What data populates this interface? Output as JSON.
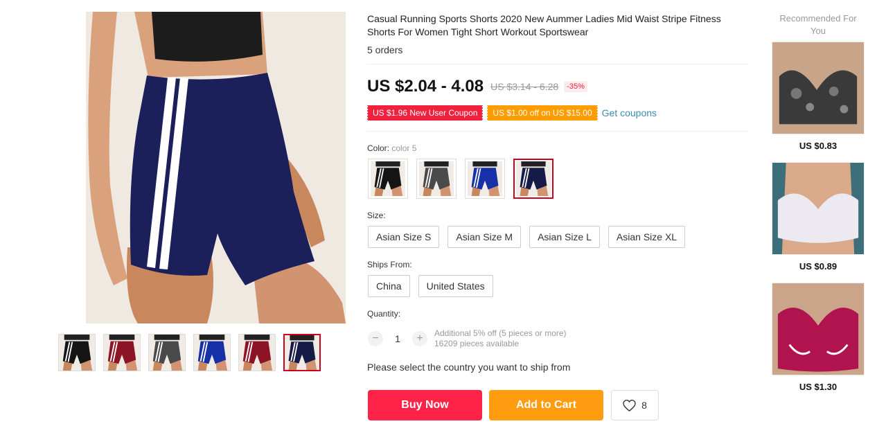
{
  "product": {
    "title": "Casual Running Sports Shorts 2020 New Aummer Ladies Mid Waist Stripe Fitness Shorts For Women Tight Short Workout Sportswear",
    "orders": "5 orders",
    "price": "US $2.04 - 4.08",
    "original_price": "US $3.14 - 6.28",
    "discount": "-35%",
    "coupons": [
      "US $1.96 New User Coupon",
      "US $1.00 off on US $15.00"
    ],
    "get_coupons": "Get coupons"
  },
  "gallery": {
    "thumb_colors": [
      "#151515",
      "#8c1424",
      "#4a4a4a",
      "#1630a8",
      "#8c1424",
      "#161a46"
    ],
    "selected_index": 5
  },
  "color": {
    "label": "Color:",
    "selected": "color 5",
    "swatch_colors": [
      "#151515",
      "#4a4a4a",
      "#1630a8",
      "#161a46"
    ]
  },
  "size": {
    "label": "Size:",
    "options": [
      "Asian Size S",
      "Asian Size M",
      "Asian Size L",
      "Asian Size XL"
    ]
  },
  "ships_from": {
    "label": "Ships From:",
    "options": [
      "China",
      "United States"
    ]
  },
  "quantity": {
    "label": "Quantity:",
    "value": "1",
    "minus": "−",
    "plus": "+",
    "note": "Additional 5% off (5 pieces or more)",
    "available": "16209 pieces available"
  },
  "ship_note": "Please select the country you want to ship from",
  "actions": {
    "buy_now": "Buy Now",
    "add_to_cart": "Add to Cart",
    "wishlist_count": "8"
  },
  "recommended": {
    "title": "Recommended For You",
    "items": [
      {
        "price": "US $0.83",
        "color": "#3a3a3a"
      },
      {
        "price": "US $0.89",
        "color": "#e8e6ea"
      },
      {
        "price": "US $1.30",
        "color": "#b0134e"
      }
    ]
  },
  "colors": {
    "accent_red": "#ff2447",
    "accent_orange": "#ff9c0f",
    "link_blue": "#3a8cb1",
    "selected_border": "#d0021b"
  }
}
